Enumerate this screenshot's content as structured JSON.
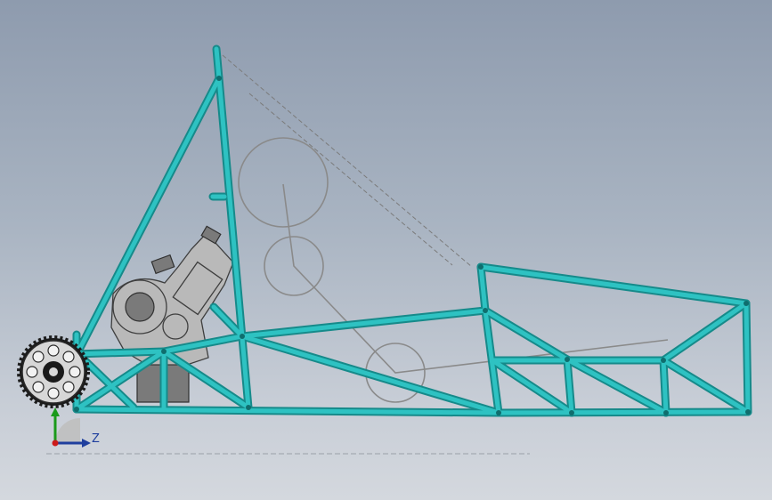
{
  "viewport": {
    "background_top": "#8e9bae",
    "background_bottom": "#d4d8de"
  },
  "frame": {
    "tube_color": "#20a6a6",
    "tube_outline": "#168a8a"
  },
  "triad": {
    "axis_label": "Z",
    "z_axis_color": "#1f3f9e",
    "y_axis_color": "#1a9a1a",
    "origin_color": "#cc1a1a"
  },
  "icons": {
    "sprocket": "sprocket-icon",
    "engine": "engine-icon",
    "triad": "coordinate-triad-icon"
  }
}
